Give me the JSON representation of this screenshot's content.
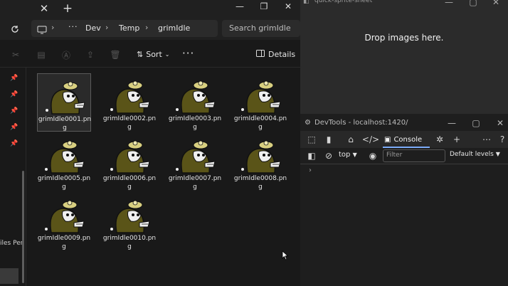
{
  "explorer": {
    "close_glyph": "✕",
    "new_tab_glyph": "+",
    "window_controls": [
      "—",
      "❐",
      "✕"
    ],
    "breadcrumb": [
      "Dev",
      "Temp",
      "grimIdle"
    ],
    "breadcrumb_more": "···",
    "breadcrumb_sep": "›",
    "search_placeholder": "Search grimIdle",
    "sort_label": "Sort",
    "more_label": "···",
    "details_label": "Details",
    "sidebar_label": "iles Per",
    "files": [
      "grimIdle0001.png",
      "grimIdle0002.png",
      "grimIdle0003.png",
      "grimIdle0004.png",
      "grimIdle0005.png",
      "grimIdle0006.png",
      "grimIdle0007.png",
      "grimIdle0008.png",
      "grimIdle0009.png",
      "grimIdle0010.png"
    ],
    "selected_index": 0
  },
  "app": {
    "title": "quick-sprite-sheet",
    "drop_text": "Drop images here.",
    "window_controls": [
      "—",
      "▢",
      "✕"
    ]
  },
  "devtools": {
    "title": "DevTools - localhost:1420/",
    "window_controls": [
      "—",
      "▢",
      "✕"
    ],
    "console_tab": "Console",
    "context": "top",
    "filter_placeholder": "Filter",
    "levels": "Default levels",
    "prompt": "›"
  },
  "colors": {
    "accent": "#7cacf8",
    "sprite_body": "#5a5418",
    "sprite_outline": "#111111"
  }
}
